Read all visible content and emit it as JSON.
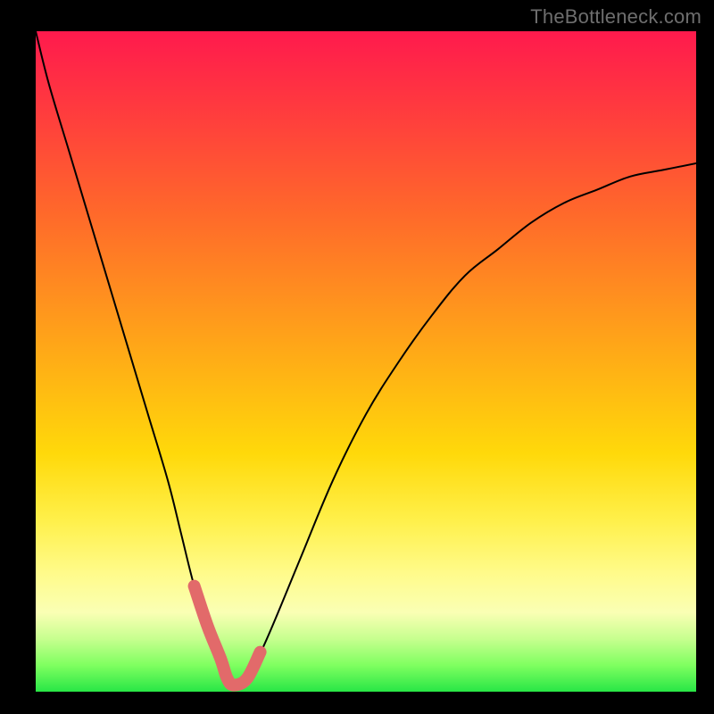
{
  "watermark": "TheBottleneck.com",
  "colors": {
    "background": "#000000",
    "gradient_top": "#ff1a4d",
    "gradient_bottom": "#28e646",
    "curve": "#000000",
    "highlight": "#e26a6a",
    "watermark": "#6e6e6e"
  },
  "chart_data": {
    "type": "line",
    "title": "",
    "xlabel": "",
    "ylabel": "",
    "xlim": [
      0,
      100
    ],
    "ylim": [
      0,
      100
    ],
    "grid": false,
    "legend": false,
    "series": [
      {
        "name": "bottleneck-curve",
        "x": [
          0,
          2,
          5,
          8,
          11,
          14,
          17,
          20,
          22,
          24,
          26,
          28,
          29,
          30,
          32,
          35,
          40,
          45,
          50,
          55,
          60,
          65,
          70,
          75,
          80,
          85,
          90,
          95,
          100
        ],
        "y": [
          100,
          92,
          82,
          72,
          62,
          52,
          42,
          32,
          24,
          16,
          10,
          5,
          2,
          1,
          2,
          8,
          20,
          32,
          42,
          50,
          57,
          63,
          67,
          71,
          74,
          76,
          78,
          79,
          80
        ]
      },
      {
        "name": "optimal-region-highlight",
        "x": [
          24,
          26,
          28,
          29,
          30,
          32,
          34
        ],
        "y": [
          16,
          10,
          5,
          2,
          1,
          2,
          6
        ]
      }
    ],
    "annotations": []
  }
}
